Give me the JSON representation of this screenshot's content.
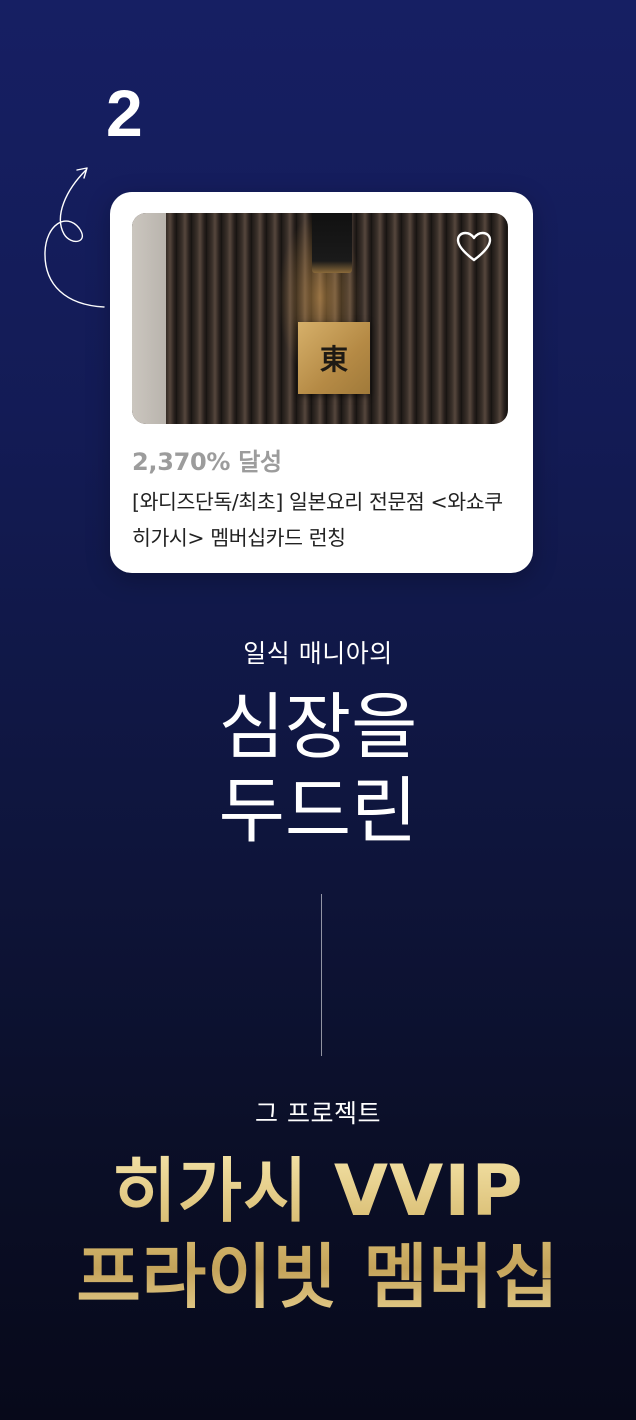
{
  "step": {
    "number": "2"
  },
  "card": {
    "image": {
      "sign_character": "東",
      "heart_icon": "heart-outline-icon"
    },
    "rate": "2,370% 달성",
    "title": "[와디즈단독/최초] 일본요리 전문점 <와쇼쿠 히가시> 멤버십카드 런칭"
  },
  "intro": {
    "subtitle": "일식 매니아의",
    "headline_line1": "심장을",
    "headline_line2": "두드린"
  },
  "project": {
    "label": "그 프로젝트",
    "title_line1": "히가시 VVIP",
    "title_line2": "프라이빗 멤버십"
  },
  "colors": {
    "background_top": "#161f63",
    "background_bottom": "#07091a",
    "gold": "#d9bd73",
    "rate_gray": "#9c9c9c"
  }
}
